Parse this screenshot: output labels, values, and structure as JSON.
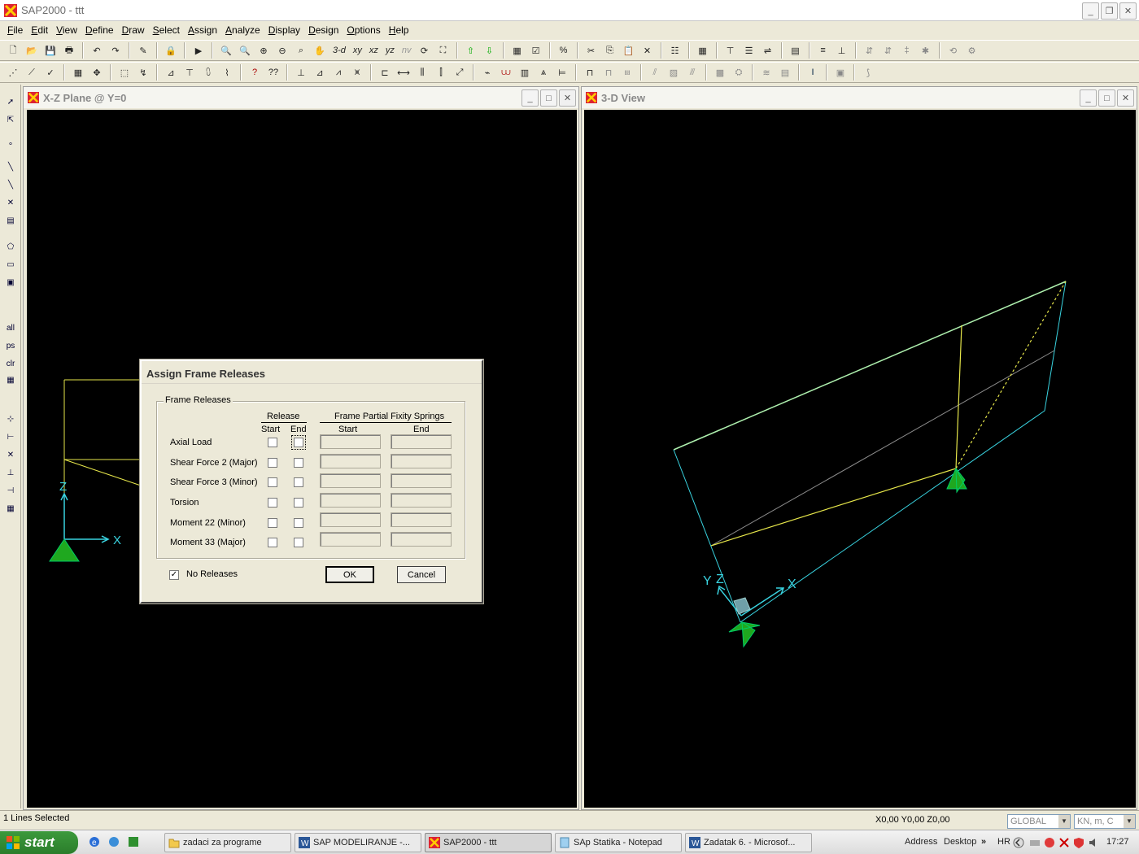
{
  "window": {
    "title": "SAP2000 - ttt"
  },
  "menu": [
    "File",
    "Edit",
    "View",
    "Define",
    "Draw",
    "Select",
    "Assign",
    "Analyze",
    "Display",
    "Design",
    "Options",
    "Help"
  ],
  "toolbar": {
    "view_3d": "3-d",
    "view_xy": "xy",
    "view_xz": "xz",
    "view_yz": "yz",
    "view_nv": "nv"
  },
  "lefttoolbar": {
    "all": "all",
    "ps": "ps",
    "clr": "clr"
  },
  "xz_window": {
    "title": "X-Z Plane @ Y=0",
    "axis_z": "Z",
    "axis_x": "X"
  },
  "view3d_window": {
    "title": "3-D View",
    "axis_y": "Y",
    "axis_z": "Z",
    "axis_x": "X"
  },
  "dialog": {
    "title": "Assign Frame Releases",
    "group_label": "Frame Releases",
    "release_header": "Release",
    "springs_header": "Frame Partial Fixity Springs",
    "col_start": "Start",
    "col_end": "End",
    "rows": [
      "Axial Load",
      "Shear Force 2 (Major)",
      "Shear Force 3 (Minor)",
      "Torsion",
      "Moment 22 (Minor)",
      "Moment 33 (Major)"
    ],
    "no_releases_label": "No Releases",
    "no_releases_checked": true,
    "ok_label": "OK",
    "cancel_label": "Cancel"
  },
  "statusbar": {
    "selection": "1 Lines Selected",
    "coords": "X0,00  Y0,00  Z0,00",
    "coord_system": "GLOBAL",
    "units": "KN, m, C"
  },
  "taskbar": {
    "start": "start",
    "tasks": [
      "zadaci za programe",
      "SAP  MODELIRANJE -...",
      "SAP2000 - ttt",
      "SAp Statika - Notepad",
      "Zadatak 6. - Microsof..."
    ],
    "address": "Address",
    "desktop": "Desktop",
    "lang": "HR",
    "clock": "17:27"
  },
  "colors": {
    "viewport_bg": "#000000",
    "frame_cyan": "#39d3e0",
    "frame_yellow": "#e6e64a",
    "support_green": "#1fa81f"
  }
}
